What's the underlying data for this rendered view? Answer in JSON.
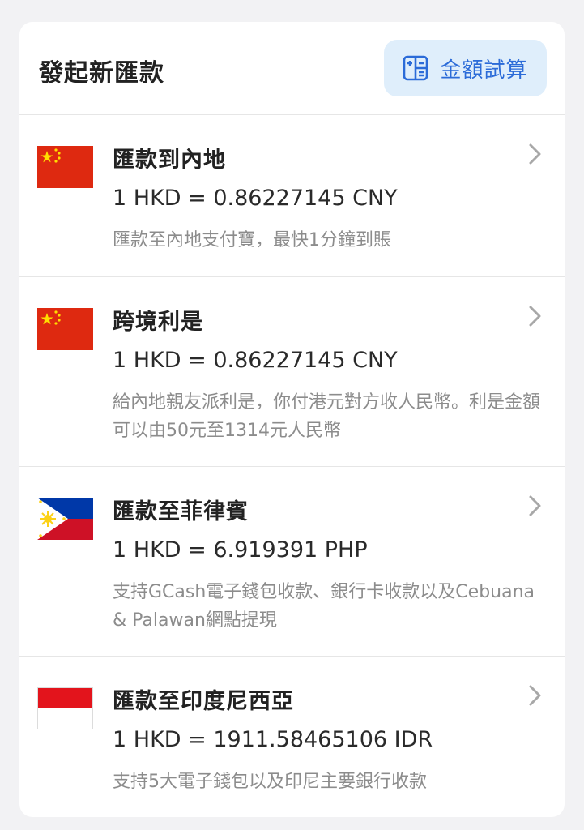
{
  "header": {
    "title": "發起新匯款",
    "calc_button_label": "金額試算",
    "calc_icon": "calculator-icon",
    "accent_color": "#2b6bd8"
  },
  "remittance_options": [
    {
      "title": "匯款到內地",
      "rate": "1 HKD = 0.86227145 CNY",
      "description": "匯款至內地支付寶，最快1分鐘到賬",
      "flag": "china-flag-icon"
    },
    {
      "title": "跨境利是",
      "rate": "1 HKD = 0.86227145 CNY",
      "description": "給內地親友派利是，你付港元對方收人民幣。利是金額可以由50元至1314元人民幣",
      "flag": "china-flag-icon"
    },
    {
      "title": "匯款至菲律賓",
      "rate": "1 HKD = 6.919391 PHP",
      "description": "支持GCash電子錢包收款、銀行卡收款以及Cebuana & Palawan網點提現",
      "flag": "philippines-flag-icon"
    },
    {
      "title": "匯款至印度尼西亞",
      "rate": "1 HKD = 1911.58465106 IDR",
      "description": "支持5大電子錢包以及印尼主要銀行收款",
      "flag": "indonesia-flag-icon"
    }
  ],
  "chevron_icon": "chevron-right-icon"
}
